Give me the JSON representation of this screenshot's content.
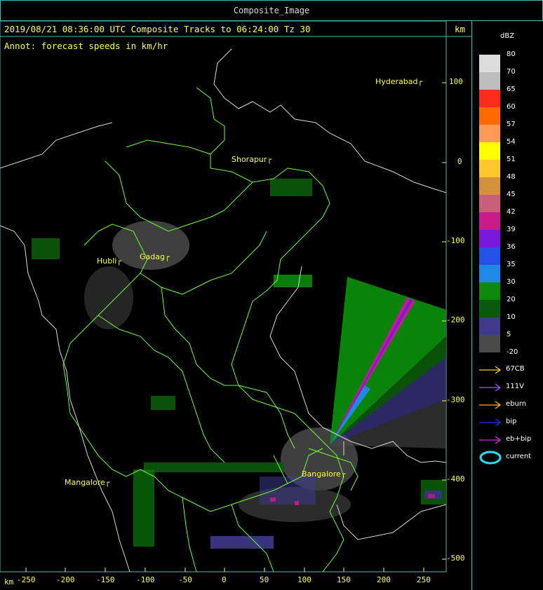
{
  "window_title": "Composite_Image",
  "header": {
    "line1": "2019/08/21 08:36:00 UTC Composite Tracks to 06:24:00 Tz 30",
    "line2": "Annot: forecast speeds in km/hr",
    "km_unit": "km"
  },
  "cities": [
    {
      "name": "Hyderabad",
      "id": "hyderabad"
    },
    {
      "name": "Shorapur",
      "id": "shorapur"
    },
    {
      "name": "Hubli",
      "id": "hubli"
    },
    {
      "name": "Gadag",
      "id": "gadag"
    },
    {
      "name": "Mangalore",
      "id": "mangalore"
    },
    {
      "name": "Bangalore",
      "id": "bangalore"
    }
  ],
  "axes": {
    "x_unit": "km",
    "x_ticks": [
      "-250",
      "-200",
      "-150",
      "-100",
      "-50",
      "0",
      "50",
      "100",
      "150",
      "200",
      "250"
    ],
    "y_ticks": [
      "100",
      "0",
      "-100",
      "-200",
      "-300",
      "-400",
      "-500"
    ]
  },
  "legend": {
    "title": "dBZ",
    "levels": [
      {
        "label": "80",
        "color": "#dcdcdc"
      },
      {
        "label": "70",
        "color": "#bdbdbd"
      },
      {
        "label": "65",
        "color": "#ff2a1a"
      },
      {
        "label": "60",
        "color": "#ff6a00"
      },
      {
        "label": "57",
        "color": "#ff9a55"
      },
      {
        "label": "54",
        "color": "#ffff00"
      },
      {
        "label": "51",
        "color": "#ffc72c"
      },
      {
        "label": "48",
        "color": "#d4903a"
      },
      {
        "label": "45",
        "color": "#c8607a"
      },
      {
        "label": "42",
        "color": "#c81c8c"
      },
      {
        "label": "39",
        "color": "#7a1ad8"
      },
      {
        "label": "36",
        "color": "#2452e8"
      },
      {
        "label": "35",
        "color": "#1e88e5"
      },
      {
        "label": "30",
        "color": "#0b8a0b"
      },
      {
        "label": "20",
        "color": "#0b5a0b"
      },
      {
        "label": "10",
        "color": "#3e3a8c"
      },
      {
        "label": "5",
        "color": "#4a4a4a"
      },
      {
        "label": "-20",
        "color": "#000000"
      }
    ],
    "tracks": [
      {
        "label": "67CB",
        "color": "#ffd000"
      },
      {
        "label": "111V",
        "color": "#a050ff"
      },
      {
        "label": "eburn",
        "color": "#ffb000"
      },
      {
        "label": "bip",
        "color": "#1a2cff"
      },
      {
        "label": "eb+bip",
        "color": "#e020e0"
      },
      {
        "label": "current",
        "color": "#22e0ff"
      }
    ]
  }
}
